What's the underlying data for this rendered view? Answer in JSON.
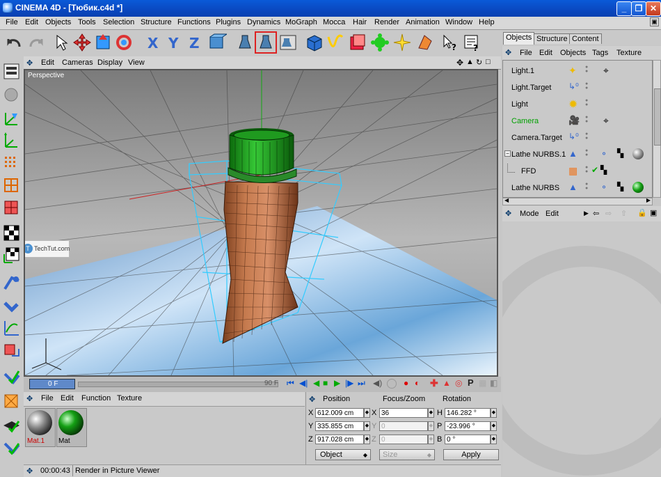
{
  "window": {
    "title": "CINEMA 4D - [Тюбик.c4d *]"
  },
  "menubar": [
    "File",
    "Edit",
    "Objects",
    "Tools",
    "Selection",
    "Structure",
    "Functions",
    "Plugins",
    "Dynamics",
    "MoGraph",
    "Mocca",
    "Hair",
    "Render",
    "Animation",
    "Window",
    "Help"
  ],
  "viewport": {
    "menu": [
      "Edit",
      "Cameras",
      "Display",
      "View"
    ],
    "label": "Perspective",
    "watermark": "TechTut.com"
  },
  "timeline": {
    "current_frame": "0 F",
    "end_frame": "90 F"
  },
  "materials": {
    "menu": [
      "File",
      "Edit",
      "Function",
      "Texture"
    ],
    "items": [
      {
        "name": "Mat.1",
        "color": "#9a9a9a",
        "name_color": "#cc0000"
      },
      {
        "name": "Mat",
        "color": "#14a014",
        "name_color": "#000000"
      }
    ]
  },
  "coords": {
    "headers": [
      "Position",
      "Focus/Zoom",
      "Rotation"
    ],
    "pos": [
      {
        "axis": "X",
        "value": "612.009 cm"
      },
      {
        "axis": "Y",
        "value": "335.855 cm"
      },
      {
        "axis": "Z",
        "value": "917.028 cm"
      }
    ],
    "size": [
      {
        "axis": "X",
        "value": "36"
      },
      {
        "axis": "Y",
        "value": "0"
      },
      {
        "axis": "Z",
        "value": "0"
      }
    ],
    "rot": [
      {
        "axis": "H",
        "value": "146.282 °"
      },
      {
        "axis": "P",
        "value": "-23.996 °"
      },
      {
        "axis": "B",
        "value": "0 °"
      }
    ],
    "mode_select": "Object",
    "size_select": "Size",
    "apply_label": "Apply"
  },
  "status": {
    "time": "00:00:43",
    "message": "Render in Picture Viewer"
  },
  "objects_panel": {
    "tabs": [
      "Objects",
      "Structure",
      "Content"
    ],
    "menu": [
      "File",
      "Edit",
      "Objects",
      "Tags",
      "Texture"
    ],
    "rows": [
      {
        "name": "Light.1",
        "color": "#000000"
      },
      {
        "name": "Light.Target",
        "color": "#000000"
      },
      {
        "name": "Light",
        "color": "#000000"
      },
      {
        "name": "Camera",
        "color": "#00a000"
      },
      {
        "name": "Camera.Target",
        "color": "#000000"
      },
      {
        "name": "Lathe NURBS.1",
        "color": "#000000"
      },
      {
        "name": "FFD",
        "color": "#000000"
      },
      {
        "name": "Lathe NURBS",
        "color": "#000000"
      }
    ]
  },
  "attributes_panel": {
    "menu": [
      "Mode",
      "Edit"
    ]
  }
}
